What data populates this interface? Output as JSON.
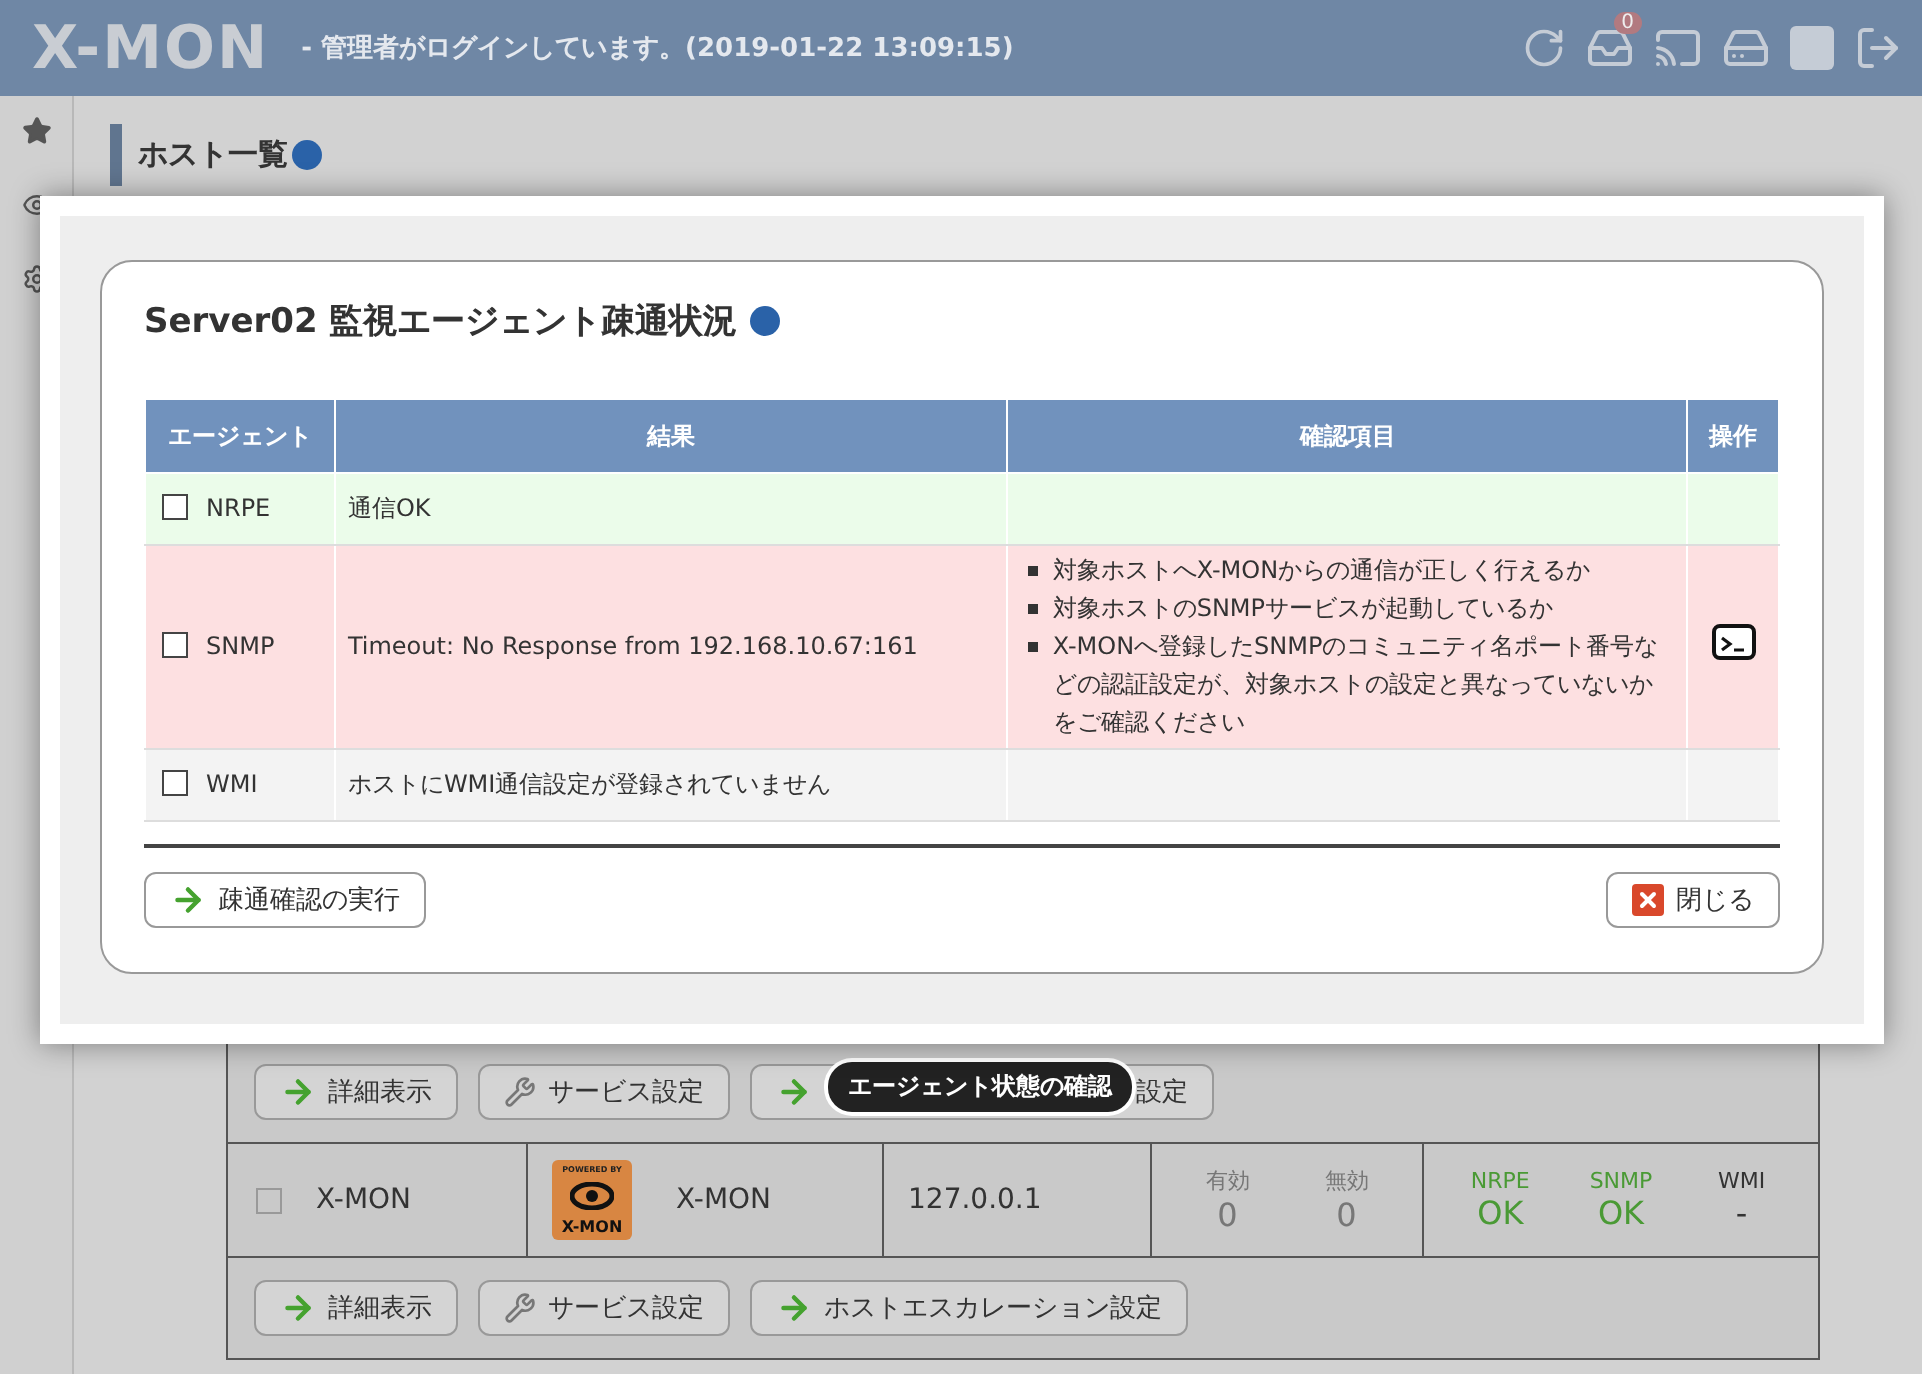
{
  "header": {
    "logo": "X-MON",
    "login_message": "-  管理者がログインしています。(2019-01-22 13:09:15)",
    "inbox_badge": "0"
  },
  "page": {
    "title": "ホスト一覧"
  },
  "dialog": {
    "title": "Server02 監視エージェント疎通状況",
    "columns": [
      "エージェント",
      "結果",
      "確認項目",
      "操作"
    ],
    "rows": [
      {
        "agent": "NRPE",
        "checked": false,
        "color": "#ebfcea",
        "result": "通信OK",
        "checks": [],
        "action": false
      },
      {
        "agent": "SNMP",
        "checked": false,
        "color": "#fde0e1",
        "result": "Timeout: No Response from 192.168.10.67:161",
        "checks": [
          "対象ホストへX-MONからの通信が正しく行えるか",
          "対象ホストのSNMPサービスが起動しているか",
          "X-MONへ登録したSNMPのコミュニティ名ポート番号などの認証設定が、対象ホストの設定と異なっていないかをご確認ください"
        ],
        "action": true
      },
      {
        "agent": "WMI",
        "checked": false,
        "color": "#f3f3f3",
        "result": "ホストにWMI通信設定が登録されていません",
        "checks": [],
        "action": false
      }
    ],
    "run_button": "疎通確認の実行",
    "close_button": "閉じる"
  },
  "host_table": {
    "top_buttons": [
      {
        "kind": "arrow",
        "label": "詳細表示"
      },
      {
        "kind": "wrench",
        "label": "サービス設定"
      },
      {
        "kind": "arrow",
        "label": "設定"
      }
    ],
    "tooltip": "エージェント状態の確認",
    "host": {
      "checked": false,
      "name": "X-MON",
      "logo_top": "POWERED BY",
      "logo_bottom": "X-MON",
      "display_name": "X-MON",
      "address": "127.0.0.1",
      "counts": [
        {
          "label": "有効",
          "value": "0"
        },
        {
          "label": "無効",
          "value": "0"
        }
      ],
      "agents": [
        {
          "label": "NRPE",
          "value": "OK",
          "color": "#4a9a35"
        },
        {
          "label": "SNMP",
          "value": "OK",
          "color": "#4a9a35"
        },
        {
          "label": "WMI",
          "value": "-",
          "color": "#333333"
        }
      ]
    },
    "bottom_buttons": [
      {
        "kind": "arrow",
        "label": "詳細表示"
      },
      {
        "kind": "wrench",
        "label": "サービス設定"
      },
      {
        "kind": "arrow",
        "label": "ホストエスカレーション設定"
      }
    ]
  }
}
